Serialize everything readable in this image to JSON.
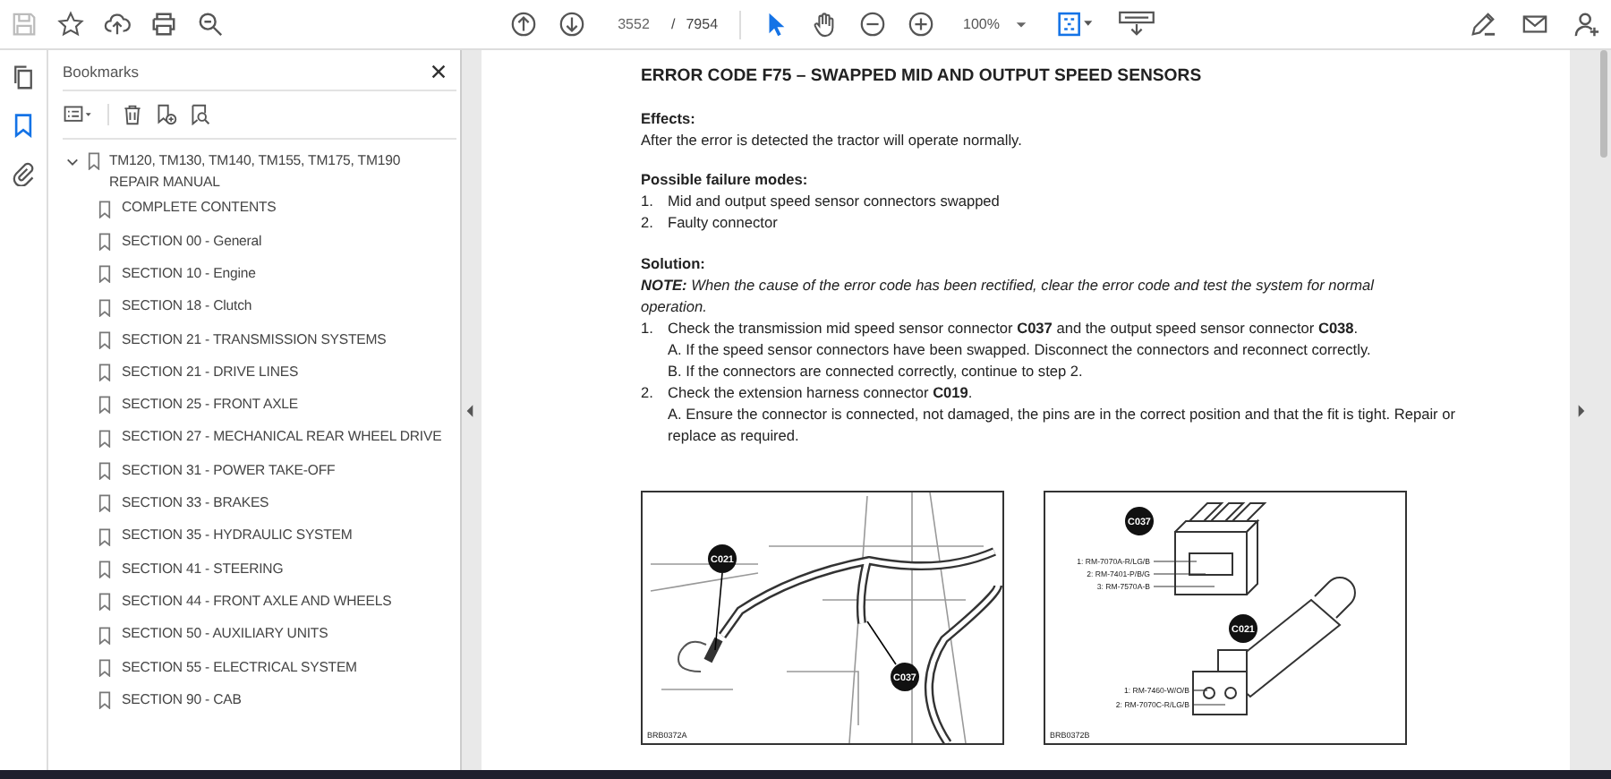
{
  "toolbar": {
    "page_current": "3552",
    "page_separator": "/",
    "page_total": "7954",
    "zoom": "100%"
  },
  "rail_tabs": [
    {
      "kind": "pages",
      "selected": false
    },
    {
      "kind": "bookmarks",
      "selected": true
    },
    {
      "kind": "attachments",
      "selected": false
    }
  ],
  "bookmarks_panel": {
    "title": "Bookmarks",
    "tree": [
      {
        "label": "TM120, TM130, TM140, TM155, TM175, TM190 REPAIR MANUAL",
        "expanded": true,
        "children": [
          {
            "label": "COMPLETE CONTENTS"
          },
          {
            "label": "SECTION 00 - General"
          },
          {
            "label": "SECTION 10 - Engine"
          },
          {
            "label": "SECTION 18 - Clutch"
          },
          {
            "label": "SECTION 21 - TRANSMISSION SYSTEMS"
          },
          {
            "label": "SECTION 21 - DRIVE LINES"
          },
          {
            "label": "SECTION 25 - FRONT AXLE"
          },
          {
            "label": "SECTION 27 - MECHANICAL REAR WHEEL DRIVE"
          },
          {
            "label": "SECTION 31 - POWER TAKE-OFF"
          },
          {
            "label": "SECTION 33 - BRAKES"
          },
          {
            "label": "SECTION 35 - HYDRAULIC SYSTEM"
          },
          {
            "label": "SECTION 41 - STEERING"
          },
          {
            "label": "SECTION 44 - FRONT AXLE AND WHEELS"
          },
          {
            "label": "SECTION 50 - AUXILIARY UNITS"
          },
          {
            "label": "SECTION 55 - ELECTRICAL SYSTEM"
          },
          {
            "label": "SECTION 90 - CAB"
          }
        ]
      }
    ]
  },
  "document": {
    "title": "ERROR CODE F75 – SWAPPED MID AND OUTPUT SPEED SENSORS",
    "effects": {
      "heading": "Effects:",
      "text": "After the error is detected the tractor will operate normally."
    },
    "failure_modes": {
      "heading": "Possible failure modes:",
      "items": [
        {
          "number": "1.",
          "text": "Mid and output speed sensor connectors swapped"
        },
        {
          "number": "2.",
          "text": "Faulty connector"
        }
      ]
    },
    "solution": {
      "heading": "Solution:",
      "note": "**NOTE:** When the cause of the error code has been rectified, clear the error code and test the system for normal operation.",
      "steps": [
        {
          "number": "1.",
          "text": "Check the transmission mid speed sensor connector **C037** and the output speed sensor connector **C038**.",
          "subitems": [
            "A. If the speed sensor connectors have been swapped. Disconnect the connectors and reconnect correctly.",
            "B. If the connectors are connected correctly, continue to step 2."
          ]
        },
        {
          "number": "2.",
          "text": "Check the extension harness connector **C019**.",
          "subitems": [
            "A. Ensure the connector is connected, not damaged, the pins are in the correct position and that the fit is tight. Repair or replace as required."
          ]
        }
      ]
    },
    "figures": [
      {
        "kind": "harness",
        "callouts": [
          "C021",
          "C037"
        ],
        "code": "BRB0372A"
      },
      {
        "kind": "connectors",
        "connectors": [
          {
            "callout": "C037",
            "pins": [
              "1: RM-7070A-R/LG/B",
              "2: RM-7401-P/B/G",
              "3: RM-7570A-B"
            ]
          },
          {
            "callout": "C021",
            "pins": [
              "1: RM-7460-W/O/B",
              "2: RM-7070C-R/LG/B"
            ]
          }
        ],
        "code": "BRB0372B"
      }
    ]
  }
}
